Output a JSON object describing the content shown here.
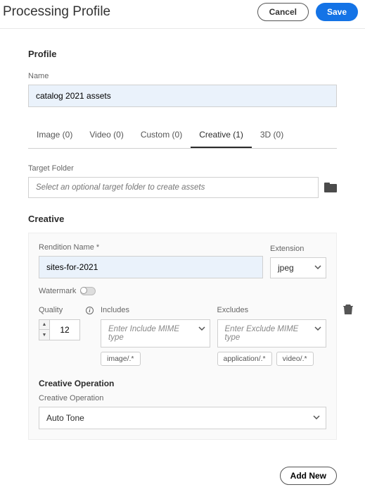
{
  "header": {
    "title": "Processing Profile",
    "cancel": "Cancel",
    "save": "Save"
  },
  "profile": {
    "section_title": "Profile",
    "name_label": "Name",
    "name_value": "catalog 2021 assets"
  },
  "tabs": [
    {
      "label": "Image (0)"
    },
    {
      "label": "Video (0)"
    },
    {
      "label": "Custom (0)"
    },
    {
      "label": "Creative (1)"
    },
    {
      "label": "3D (0)"
    }
  ],
  "target_folder": {
    "label": "Target Folder",
    "placeholder": "Select an optional target folder to create assets"
  },
  "creative": {
    "section_title": "Creative",
    "rendition_name_label": "Rendition Name *",
    "rendition_name_value": "sites-for-2021",
    "extension_label": "Extension",
    "extension_value": "jpeg",
    "watermark_label": "Watermark",
    "quality_label": "Quality",
    "quality_value": "12",
    "includes_label": "Includes",
    "includes_placeholder": "Enter Include MIME type",
    "include_tags": [
      "image/.*"
    ],
    "excludes_label": "Excludes",
    "excludes_placeholder": "Enter Exclude MIME type",
    "exclude_tags": [
      "application/.*",
      "video/.*"
    ],
    "operation_title": "Creative Operation",
    "operation_label": "Creative Operation",
    "operation_value": "Auto Tone"
  },
  "footer": {
    "add_new": "Add New"
  }
}
